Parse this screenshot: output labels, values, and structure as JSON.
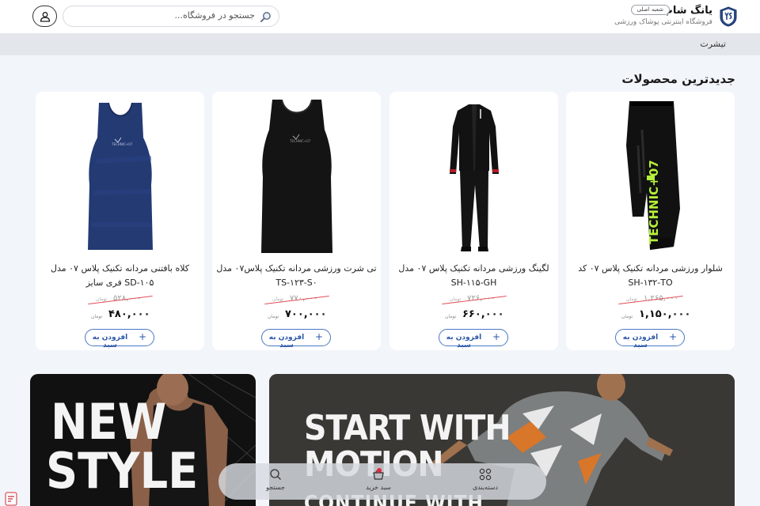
{
  "header": {
    "shop_name": "یانگ شاپ",
    "branch_badge": "شعبه اصلی",
    "tagline": "فروشگاه اینترنتی پوشاک ورزشی",
    "search_placeholder": "جستجو در فروشگاه...",
    "logo_letters": "YS"
  },
  "category_bar": {
    "active_tab": "تیشرت"
  },
  "section": {
    "title": "جدیدترین محصولات"
  },
  "products": [
    {
      "title": "شلوار ورزشی مردانه تکنیک پلاس ۰۷ کد SH-۱۳۲-TO",
      "old_price": "۱,۲۶۵,۰۰۰",
      "price": "۱,۱۵۰,۰۰۰",
      "unit": "تومان",
      "add_label": "افزودن به سبد",
      "image": "black-shorts-lime-print"
    },
    {
      "title": "لگینگ ورزشی مردانه تکنیک پلاس ۰۷ مدل SH-۱۱۵-GH",
      "old_price": "۷۲۶,۰۰۰",
      "price": "۶۶۰,۰۰۰",
      "unit": "تومان",
      "add_label": "افزودن به سبد",
      "image": "black-tracksuit"
    },
    {
      "title": "تی شرت ورزشی مردانه تکنیک پلاس۰۷ مدل TS-۱۲۳-S۰",
      "old_price": "۷۷۰,۰۰۰",
      "price": "۷۰۰,۰۰۰",
      "unit": "تومان",
      "add_label": "افزودن به سبد",
      "image": "black-tank-top"
    },
    {
      "title": "کلاه بافتنی مردانه تکنیک پلاس ۰۷ مدل SD-۱۰۵ فری سایز",
      "old_price": "۵۲۸,۰۰۰",
      "price": "۴۸۰,۰۰۰",
      "unit": "تومان",
      "add_label": "افزودن به سبد",
      "image": "navy-tank-top"
    }
  ],
  "banners": {
    "left": {
      "line1": "NEW",
      "line2": "STYLE"
    },
    "right": {
      "line1": "START WITH",
      "line2": "MOTION",
      "line3": "CONTINUE WITH"
    }
  },
  "bottom_nav": {
    "items": [
      {
        "label": "دسته‌بندی",
        "icon": "grid-icon"
      },
      {
        "label": "سبد خرید",
        "icon": "basket-icon"
      },
      {
        "label": "جستجو",
        "icon": "search-icon"
      }
    ]
  },
  "colors": {
    "accent": "#2b56a8",
    "strike": "#e14c57",
    "page_bg": "#f2f5fa"
  }
}
